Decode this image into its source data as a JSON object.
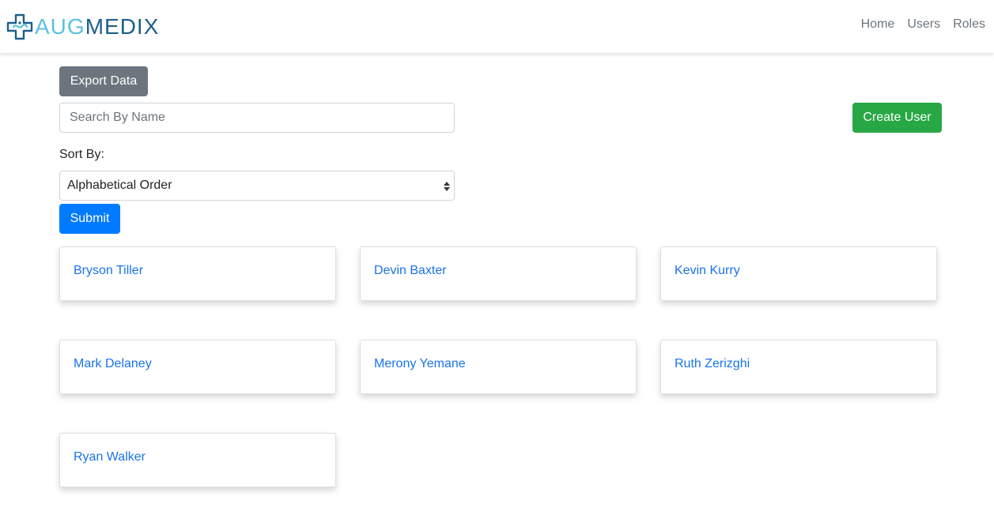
{
  "brand": {
    "logo_icon": "medical-cross-icon",
    "name_part1": "AUG",
    "name_part2": "MEDIX",
    "colors": {
      "aug": "#5bc0de",
      "medix": "#1d5f8c"
    }
  },
  "nav": {
    "items": [
      {
        "label": "Home"
      },
      {
        "label": "Users"
      },
      {
        "label": "Roles"
      }
    ]
  },
  "toolbar": {
    "export_label": "Export Data",
    "create_label": "Create User",
    "submit_label": "Submit"
  },
  "search": {
    "placeholder": "Search By Name",
    "value": ""
  },
  "sort": {
    "label": "Sort By:",
    "selected": "Alphabetical Order"
  },
  "users": [
    {
      "name": "Bryson Tiller"
    },
    {
      "name": "Devin Baxter"
    },
    {
      "name": "Kevin Kurry"
    },
    {
      "name": "Mark Delaney"
    },
    {
      "name": "Merony Yemane"
    },
    {
      "name": "Ruth Zerizghi"
    },
    {
      "name": "Ryan Walker"
    }
  ],
  "colors": {
    "export_button": "#6c757d",
    "create_button": "#28a745",
    "submit_button": "#007bff",
    "user_link": "#1a73e8"
  }
}
